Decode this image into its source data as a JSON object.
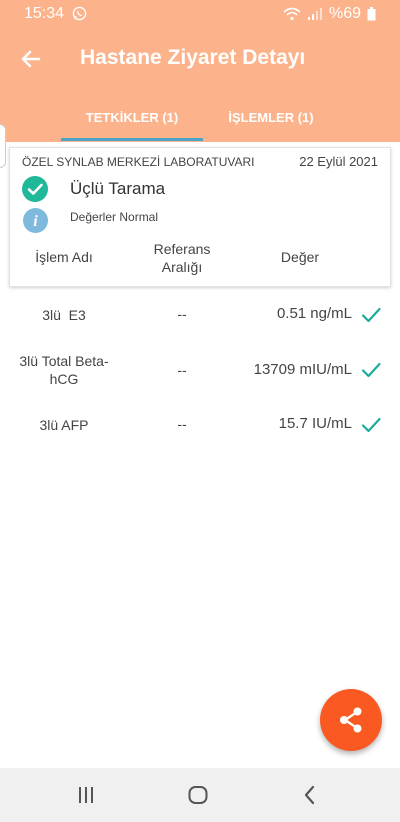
{
  "status_bar": {
    "time": "15:34",
    "battery": "%69"
  },
  "header": {
    "title": "Hastane Ziyaret Detayı"
  },
  "tabs": [
    {
      "label": "TETKİKLER (1)",
      "active": true
    },
    {
      "label": "İŞLEMLER (1)",
      "active": false
    }
  ],
  "card": {
    "lab_name": "ÖZEL SYNLAB MERKEZİ LABORATUVARI",
    "date": "22 Eylül 2021",
    "test_name": "Üçlü Tarama",
    "status": "Değerler Normal",
    "columns": {
      "name": "İşlem Adı",
      "reference": "Referans Aralığı",
      "value": "Değer"
    }
  },
  "results": [
    {
      "name": "3lü  E3",
      "reference": "--",
      "value": "0.51 ng/mL"
    },
    {
      "name": "3lü Total Beta-hCG",
      "reference": "--",
      "value": "13709 mIU/mL"
    },
    {
      "name": "3lü AFP",
      "reference": "--",
      "value": "15.7 IU/mL"
    }
  ],
  "icons": {
    "back": "arrow-left-icon",
    "check": "check-circle-icon",
    "info": "info-icon",
    "row_check": "checkmark-icon",
    "fab": "share-icon",
    "nav": [
      "recent-apps-icon",
      "home-icon",
      "back-icon"
    ]
  },
  "colors": {
    "header_bg": "#fcb28a",
    "tab_indicator": "#4ba3c7",
    "check_green": "#1fb898",
    "info_blue": "#7fb9dd",
    "fab_orange": "#fa5a22",
    "row_check": "#1aab9a"
  }
}
